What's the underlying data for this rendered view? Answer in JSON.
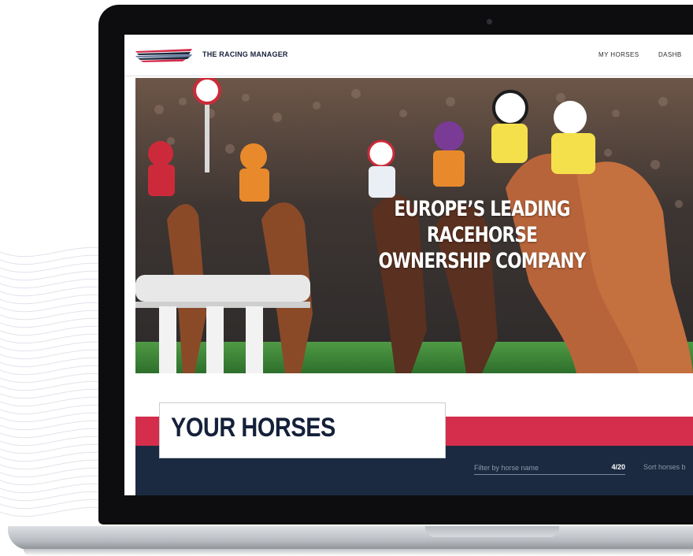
{
  "brand": {
    "name": "THE RACING MANAGER"
  },
  "nav": {
    "items": [
      "MY HORSES",
      "DASHB"
    ]
  },
  "hero": {
    "title_line1": "EUROPE’S LEADING RACEHORSE",
    "title_line2": "OWNERSHIP COMPANY"
  },
  "horses_section": {
    "title": "YOUR HORSES",
    "filter_placeholder": "Filter by horse name",
    "count": "4/20",
    "sort_label": "Sort horses b"
  },
  "colors": {
    "accent_red": "#d42e4c",
    "navy": "#1b2a41",
    "grass": "#3d8b3a"
  }
}
